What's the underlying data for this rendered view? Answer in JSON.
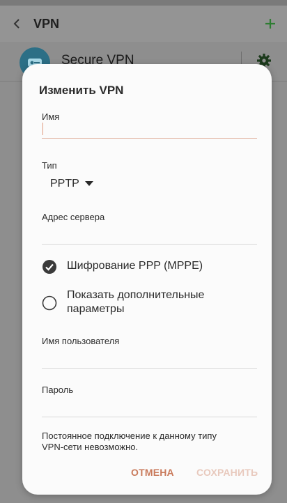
{
  "appbar": {
    "title": "VPN"
  },
  "vpn_list": [
    {
      "label": "Secure VPN"
    }
  ],
  "dialog": {
    "title": "Изменить VPN",
    "name_label": "Имя",
    "name_value": "",
    "type_label": "Тип",
    "type_value": "PPTP",
    "server_label": "Адрес сервера",
    "server_value": "",
    "encryption_label": "Шифрование PPP (MPPE)",
    "encryption_checked": true,
    "advanced_label_line1": "Показать дополнительные",
    "advanced_label_line2": "параметры",
    "advanced_checked": false,
    "username_label": "Имя пользователя",
    "username_value": "",
    "password_label": "Пароль",
    "password_value": "",
    "note_line1": "Постоянное подключение к данному типу",
    "note_line2": "VPN-сети невозможно.",
    "cancel_label": "ОТМЕНА",
    "save_label": "СОХРАНИТЬ"
  },
  "colors": {
    "accent": "#c97a5b",
    "accent_disabled": "#e8c9bd",
    "appbar_plus": "#2e7d32"
  },
  "icons": {
    "back": "chevron-left-icon",
    "add": "plus-icon",
    "settings": "gear-icon",
    "dropdown": "triangle-down-icon",
    "check": "check-circle-icon",
    "radio": "radio-empty-icon"
  }
}
